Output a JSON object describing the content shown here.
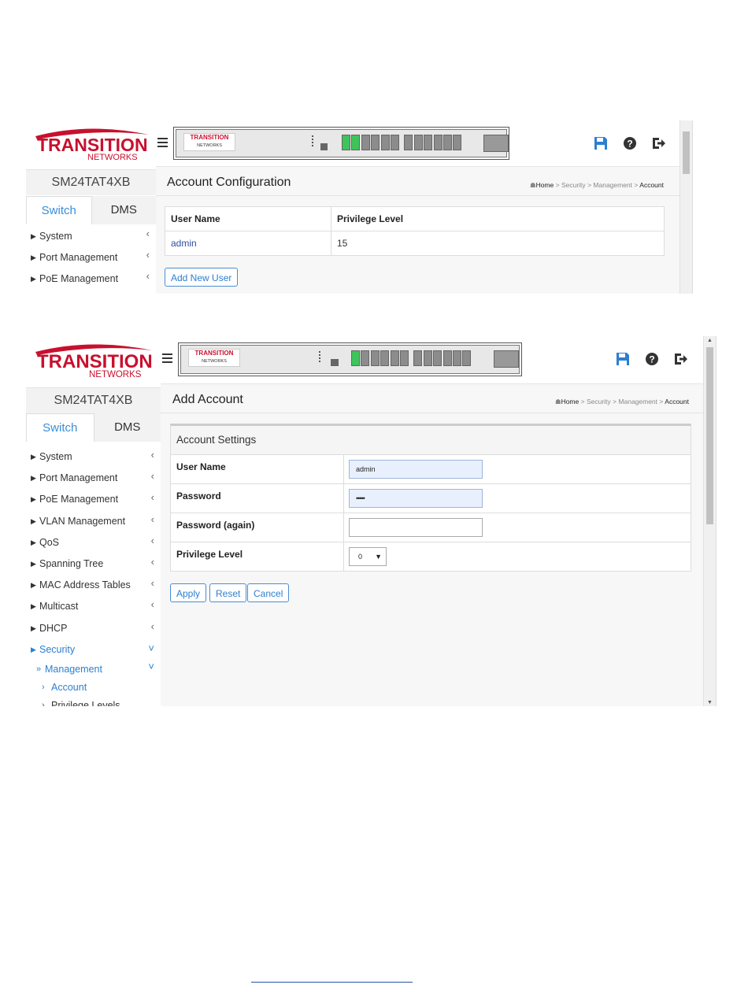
{
  "brand": {
    "logo_main": "TRANSITION",
    "logo_sub": "NETWORKS",
    "colors": {
      "brand_red": "#c8102e",
      "link_blue": "#2d7fcf",
      "port_green": "#3ec45a"
    }
  },
  "device_name": "SM24TAT4XB",
  "tabs": [
    {
      "label": "Switch",
      "active": true
    },
    {
      "label": "DMS",
      "active": false
    }
  ],
  "header_icons": [
    "save-icon",
    "help-icon",
    "logout-icon"
  ],
  "panel_logo": {
    "main": "TRANSITION",
    "sub": "NETWORKS"
  },
  "screen1": {
    "menu": [
      "System",
      "Port Management",
      "PoE Management"
    ],
    "title": "Account Configuration",
    "breadcrumb": [
      "Home",
      ">",
      "Security",
      ">",
      "Management",
      ">",
      "Account"
    ],
    "table": {
      "headers": [
        "User Name",
        "Privilege Level"
      ],
      "rows": [
        [
          "admin",
          "15"
        ]
      ]
    },
    "add_button": "Add New User"
  },
  "screen2": {
    "menu": [
      "System",
      "Port Management",
      "PoE Management",
      "VLAN Management",
      "QoS",
      "Spanning Tree",
      "MAC Address Tables",
      "Multicast",
      "DHCP"
    ],
    "menu_security": "Security",
    "menu_management": "Management",
    "menu_account": "Account",
    "menu_privilege": "Privilege Levels",
    "title": "Add Account",
    "breadcrumb": [
      "Home",
      ">",
      "Security",
      ">",
      "Management",
      ">",
      "Account"
    ],
    "settings_title": "Account Settings",
    "fields": [
      {
        "label": "User Name",
        "value": "admin"
      },
      {
        "label": "Password",
        "value": "•••••"
      },
      {
        "label": "Password (again)",
        "value": ""
      },
      {
        "label": "Privilege Level",
        "value": "0"
      }
    ],
    "buttons": {
      "apply": "Apply",
      "reset": "Reset",
      "cancel": "Cancel"
    }
  }
}
